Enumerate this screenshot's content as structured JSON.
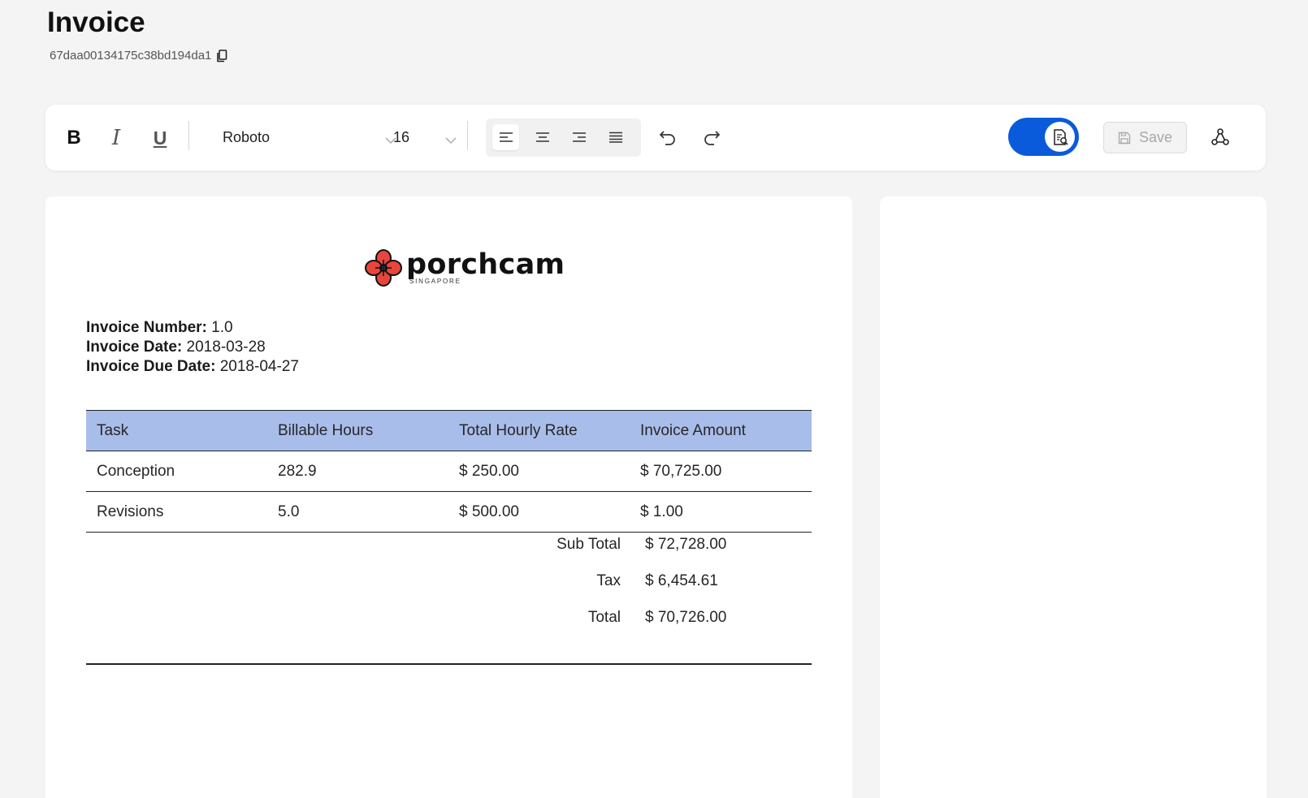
{
  "header": {
    "title": "Invoice",
    "doc_id": "67daa00134175c38bd194da1"
  },
  "toolbar": {
    "bold_label": "B",
    "italic_label": "I",
    "underline_label": "U",
    "font_family": "Roboto",
    "font_size": "16",
    "save_label": "Save",
    "toggle_color": "#0a5bdb"
  },
  "invoice": {
    "logo": {
      "name": "porchcam",
      "sub": "SINGAPORE"
    },
    "meta": [
      {
        "label": "Invoice Number:",
        "value": "1.0"
      },
      {
        "label": "Invoice Date:",
        "value": "2018-03-28"
      },
      {
        "label": "Invoice Due Date:",
        "value": "2018-04-27"
      }
    ],
    "columns": [
      "Task",
      "Billable Hours",
      "Total Hourly Rate",
      "Invoice Amount"
    ],
    "rows": [
      [
        "Conception",
        "282.9",
        "$ 250.00",
        "$ 70,725.00"
      ],
      [
        "Revisions",
        "5.0",
        "$ 500.00",
        "$ 1.00"
      ]
    ],
    "totals": [
      {
        "label": "Sub Total",
        "value": "$ 72,728.00"
      },
      {
        "label": "Tax",
        "value": "$ 6,454.61"
      },
      {
        "label": "Total",
        "value": "$ 70,726.00"
      }
    ],
    "header_color": "#a9bdea"
  }
}
